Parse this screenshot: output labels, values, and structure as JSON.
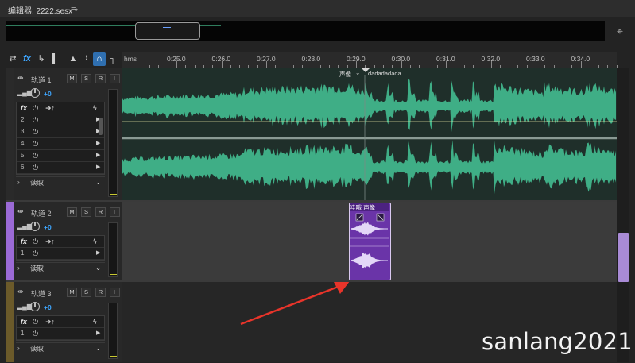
{
  "window": {
    "title": "编辑器: 2222.sesx *",
    "menu_icon": "hamburger-icon"
  },
  "toolbar": {
    "icons": [
      "swap-icon",
      "fx-icon",
      "send-icon",
      "bars-icon",
      "metronome-icon",
      "tune-icon",
      "headphone-icon",
      "pin-icon"
    ]
  },
  "ruler": {
    "unit": "hms",
    "labels": [
      "0:25.0",
      "0:26.0",
      "0:27.0",
      "0:28.0",
      "0:29.0",
      "0:30.0",
      "0:31.0",
      "0:32.0",
      "0:33.0",
      "0:34.0"
    ]
  },
  "tracks": [
    {
      "name": "轨道 1",
      "volume": "+0",
      "m": "M",
      "s": "S",
      "r": "R",
      "i": "I",
      "fx_rows": [
        "2",
        "3",
        "4",
        "5",
        "6"
      ],
      "read": "读取"
    },
    {
      "name": "轨道 2",
      "volume": "+0",
      "m": "M",
      "s": "S",
      "r": "R",
      "i": "I",
      "fx_rows": [
        "1"
      ],
      "read": "读取"
    },
    {
      "name": "轨道 3",
      "volume": "+0",
      "m": "M",
      "s": "S",
      "r": "R",
      "i": "I",
      "fx_rows": [
        "1"
      ],
      "read": "读取"
    }
  ],
  "clips": {
    "track1_a_label": "声像",
    "track1_b_label": "dadadadada",
    "track2_clip_label": "哇哦 声像"
  },
  "fx_label": "fx",
  "watermark": "sanlang2021",
  "colors": {
    "wave_green": "#3fae86",
    "clip_purple": "#6a34a8",
    "track2_stripe": "#9b6ad6",
    "track3_stripe": "#6b5a2a"
  }
}
